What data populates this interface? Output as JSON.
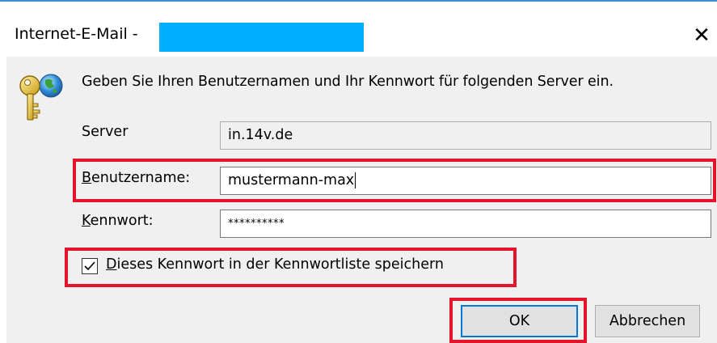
{
  "window": {
    "title": "Internet-E-Mail -",
    "close_glyph": "✕"
  },
  "prompt": "Geben Sie Ihren Benutzernamen und Ihr Kennwort für folgenden Server ein.",
  "fields": {
    "server": {
      "label": "Server",
      "value": "in.14v.de"
    },
    "username": {
      "label_mnemonic": "B",
      "label_rest": "enutzername:",
      "value": "mustermann-max"
    },
    "password": {
      "label_mnemonic": "K",
      "label_rest": "ennwort:",
      "value": "**********"
    }
  },
  "save_password": {
    "checked": true,
    "label_mnemonic": "D",
    "label_rest": "ieses Kennwort in der Kennwortliste speichern"
  },
  "buttons": {
    "ok": "OK",
    "cancel": "Abbrechen"
  },
  "colors": {
    "redaction": "#00aeff",
    "highlight": "#e3142b",
    "focus": "#0078d7"
  }
}
